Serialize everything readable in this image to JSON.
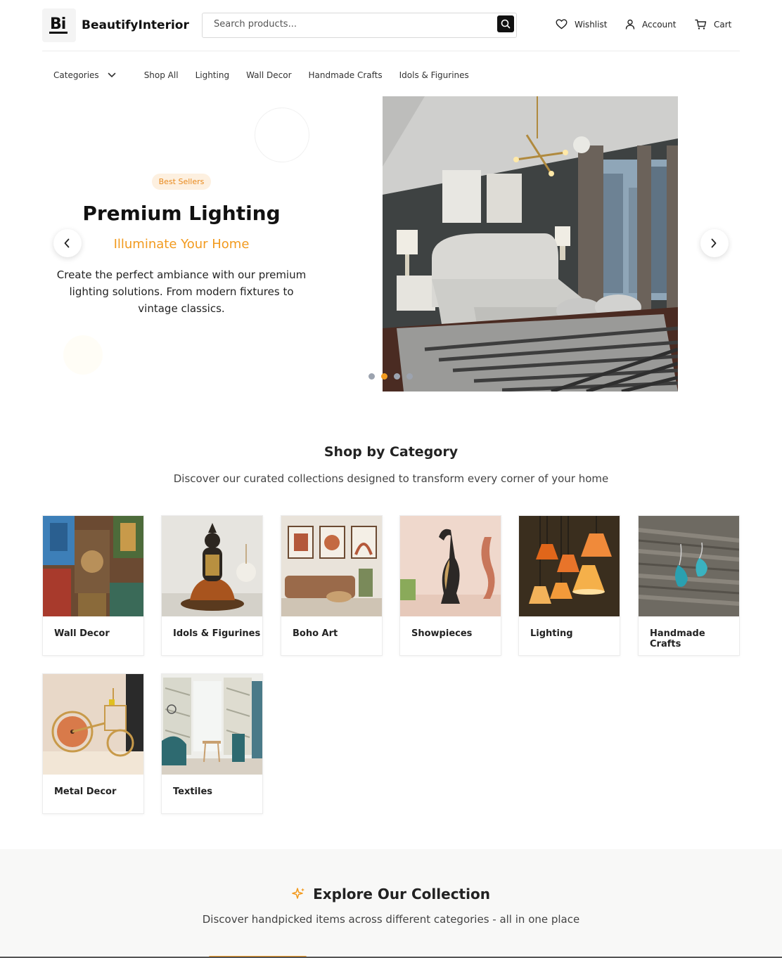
{
  "brand": {
    "name": "BeautifyInterior",
    "logo_text": "Bi"
  },
  "search": {
    "placeholder": "Search products..."
  },
  "header_links": {
    "wishlist": "Wishlist",
    "account": "Account",
    "cart": "Cart"
  },
  "nav": {
    "categories": "Categories",
    "links": [
      "Shop All",
      "Lighting",
      "Wall Decor",
      "Handmade Crafts",
      "Idols & Figurines"
    ]
  },
  "hero": {
    "badge": "Best Sellers",
    "title": "Premium Lighting",
    "subtitle": "Illuminate Your Home",
    "description": "Create the perfect ambiance with our premium lighting solutions. From modern fixtures to vintage classics.",
    "slide_count": 4,
    "active_slide": 2
  },
  "categories_section": {
    "title": "Shop by Category",
    "description": "Discover our curated collections designed to transform every corner of your home",
    "items": [
      "Wall Decor",
      "Idols & Figurines",
      "Boho Art",
      "Showpieces",
      "Lighting",
      "Handmade Crafts",
      "Metal Decor",
      "Textiles"
    ]
  },
  "explore": {
    "title": "Explore Our Collection",
    "description": "Discover handpicked items across different categories - all in one place"
  },
  "colors": {
    "accent": "#f29a1e",
    "badge_bg": "#fdf0e0",
    "dark": "#111111"
  }
}
